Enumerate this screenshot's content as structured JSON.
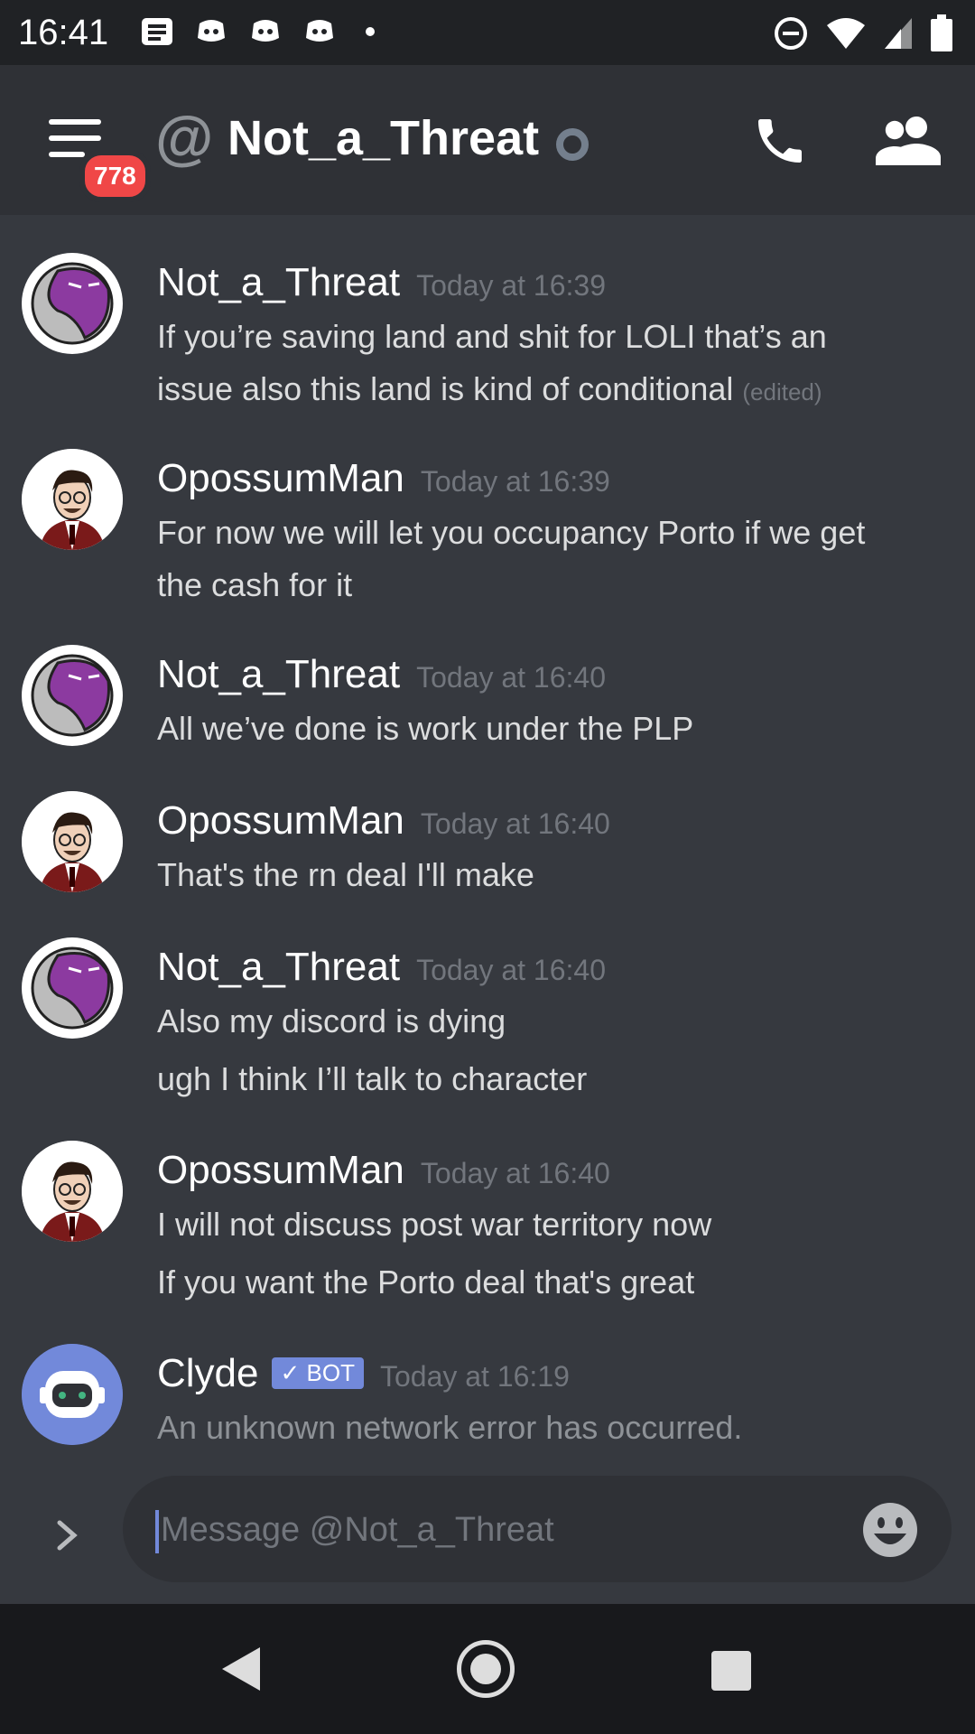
{
  "status_bar": {
    "time": "16:41"
  },
  "header": {
    "menu_badge": "778",
    "at_symbol": "@",
    "channel_name": "Not_a_Threat"
  },
  "messages": [
    {
      "author": "Not_a_Threat",
      "timestamp": "Today at 16:39",
      "lines": [
        "If you’re saving land and shit for LOLI that’s an",
        "issue also this land is kind of conditional"
      ],
      "edited": "(edited)"
    },
    {
      "author": "OpossumMan",
      "timestamp": "Today at 16:39",
      "lines": [
        "For now we will let you occupancy Porto if we get",
        "the cash for it"
      ]
    },
    {
      "author": "Not_a_Threat",
      "timestamp": "Today at 16:40",
      "lines": [
        "All we’ve done is work under the PLP"
      ]
    },
    {
      "author": "OpossumMan",
      "timestamp": "Today at 16:40",
      "lines": [
        "That's the rn deal I'll make"
      ]
    },
    {
      "author": "Not_a_Threat",
      "timestamp": "Today at 16:40",
      "lines": [
        "Also my discord is dying",
        "ugh I think I’ll talk to character"
      ]
    },
    {
      "author": "OpossumMan",
      "timestamp": "Today at 16:40",
      "lines": [
        "I will not discuss post war territory now",
        "If you want the Porto deal that's great"
      ]
    },
    {
      "author": "Clyde",
      "bot_tag": "✓ BOT",
      "timestamp": "Today at 16:19",
      "lines": [
        "An unknown network error has occurred."
      ]
    }
  ],
  "composer": {
    "placeholder": "Message @Not_a_Threat"
  },
  "colors": {
    "background": "#36393f",
    "header": "#2f3136",
    "accent": "#7289da",
    "badge": "#f04747",
    "status_bar": "#202225"
  }
}
